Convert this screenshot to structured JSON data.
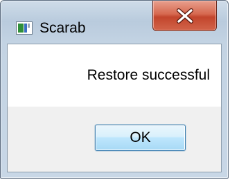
{
  "window": {
    "title": "Scarab",
    "close_icon": "close-x-icon",
    "app_icon": "window-app-icon"
  },
  "dialog": {
    "message": "Restore successful",
    "ok_label": "OK"
  },
  "colors": {
    "close_button": "#c74a30",
    "ok_border": "#3c7fb1",
    "frame": "#c3d3e3"
  }
}
